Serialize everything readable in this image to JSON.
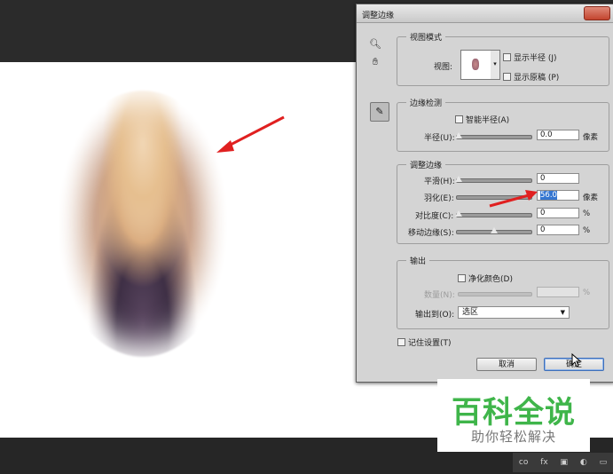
{
  "dialog": {
    "title": "调整边缘",
    "view_mode": {
      "group_title": "视图模式",
      "view_label": "视图:",
      "show_radius": "显示半径 (J)",
      "show_original": "显示原稿 (P)"
    },
    "edge_detection": {
      "group_title": "边缘检测",
      "smart_radius": "智能半径(A)",
      "radius_label": "半径(U):",
      "radius_value": "0.0",
      "radius_unit": "像素"
    },
    "adjust_edge": {
      "group_title": "调整边缘",
      "smooth_label": "平滑(H):",
      "smooth_value": "0",
      "feather_label": "羽化(E):",
      "feather_value": "56.0",
      "feather_unit": "像素",
      "contrast_label": "对比度(C):",
      "contrast_value": "0",
      "contrast_unit": "%",
      "shift_label": "移动边缘(S):",
      "shift_value": "0",
      "shift_unit": "%"
    },
    "output": {
      "group_title": "输出",
      "decontaminate": "净化颜色(D)",
      "amount_label": "数量(N):",
      "amount_unit": "%",
      "output_to_label": "输出到(O):",
      "output_to_value": "选区"
    },
    "remember": "记住设置(T)",
    "cancel": "取消",
    "ok": "确定"
  },
  "watermark": {
    "main": "百科全说",
    "sub": "助你轻松解决"
  },
  "panel_icons": [
    "co",
    "fx",
    "▣",
    "◐",
    "▭"
  ],
  "colors": {
    "annotation_arrow": "#e02020",
    "watermark_green": "#3fb54a",
    "selection_blue": "#3476d1"
  }
}
